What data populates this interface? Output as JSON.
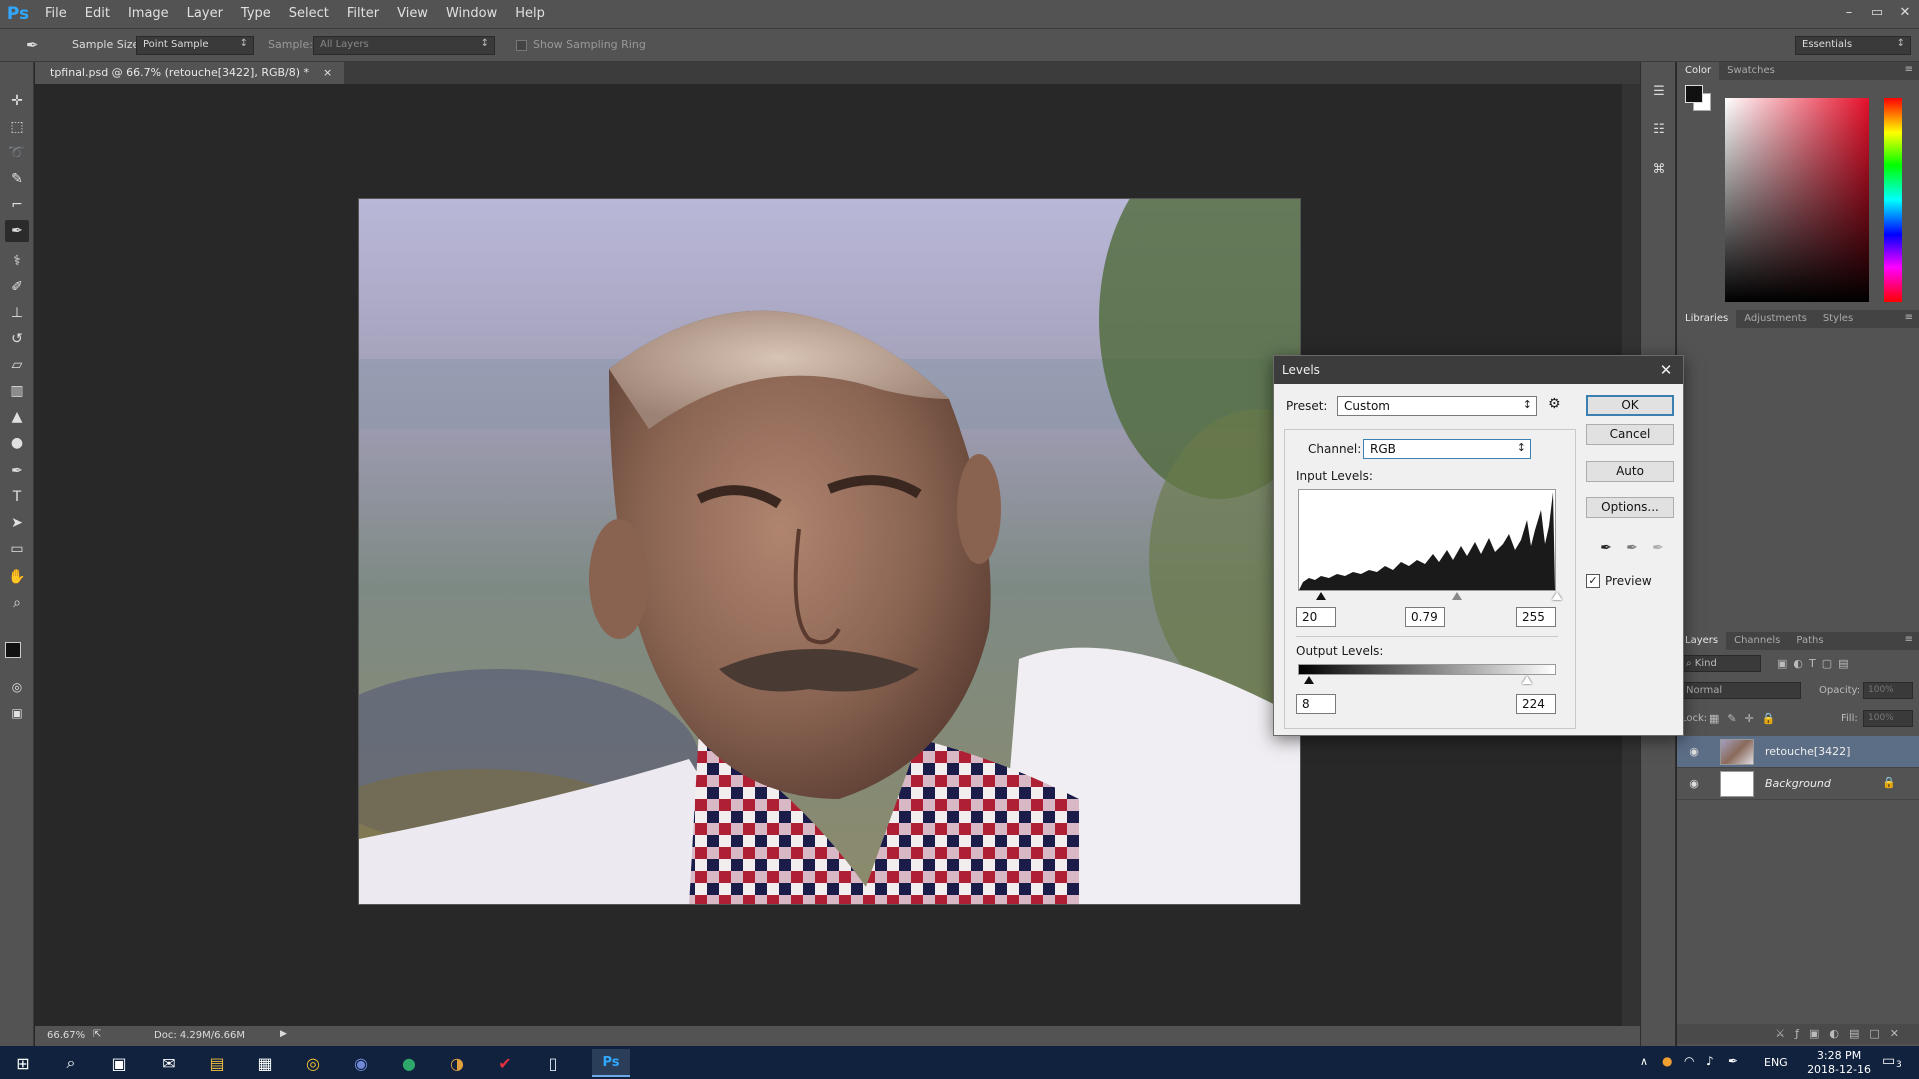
{
  "app": {
    "logo": "Ps"
  },
  "menu": [
    "File",
    "Edit",
    "Image",
    "Layer",
    "Type",
    "Select",
    "Filter",
    "View",
    "Window",
    "Help"
  ],
  "window_controls": [
    "–",
    "▭",
    "✕"
  ],
  "options_bar": {
    "sample_size_label": "Sample Size:",
    "sample_size_value": "Point Sample",
    "sample_label": "Sample:",
    "sample_value": "All Layers",
    "sampling_ring_label": "Show Sampling Ring",
    "workspace": "Essentials"
  },
  "document": {
    "tab_title": "tpfinal.psd @ 66.7% (retouche[3422], RGB/8) *",
    "close": "×"
  },
  "status": {
    "zoom": "66.67%",
    "doc_size": "Doc: 4.29M/6.66M"
  },
  "color_panel": {
    "tabs": [
      "Color",
      "Swatches"
    ],
    "foreground": "#111111",
    "background": "#ffffff"
  },
  "libraries_panel": {
    "tabs": [
      "Libraries",
      "Adjustments",
      "Styles"
    ]
  },
  "layers_panel": {
    "tabs": [
      "Layers",
      "Channels",
      "Paths"
    ],
    "filter_label": "Kind",
    "blend_mode": "Normal",
    "opacity_label": "Opacity:",
    "opacity_value": "100%",
    "lock_label": "Lock:",
    "fill_label": "Fill:",
    "fill_value": "100%",
    "layers": [
      {
        "name": "retouche[3422]",
        "selected": true,
        "locked": false
      },
      {
        "name": "Background",
        "selected": false,
        "locked": true
      }
    ]
  },
  "levels_dialog": {
    "title": "Levels",
    "preset_label": "Preset:",
    "preset_value": "Custom",
    "channel_label": "Channel:",
    "channel_value": "RGB",
    "input_levels_label": "Input Levels:",
    "input_black": "20",
    "input_gamma": "0.79",
    "input_white": "255",
    "output_levels_label": "Output Levels:",
    "output_black": "8",
    "output_white": "224",
    "buttons": {
      "ok": "OK",
      "cancel": "Cancel",
      "auto": "Auto",
      "options": "Options..."
    },
    "preview_label": "Preview",
    "preview_checked": true
  },
  "taskbar": {
    "language": "ENG",
    "time": "3:28 PM",
    "date": "2018-12-16",
    "notifications": "3"
  }
}
